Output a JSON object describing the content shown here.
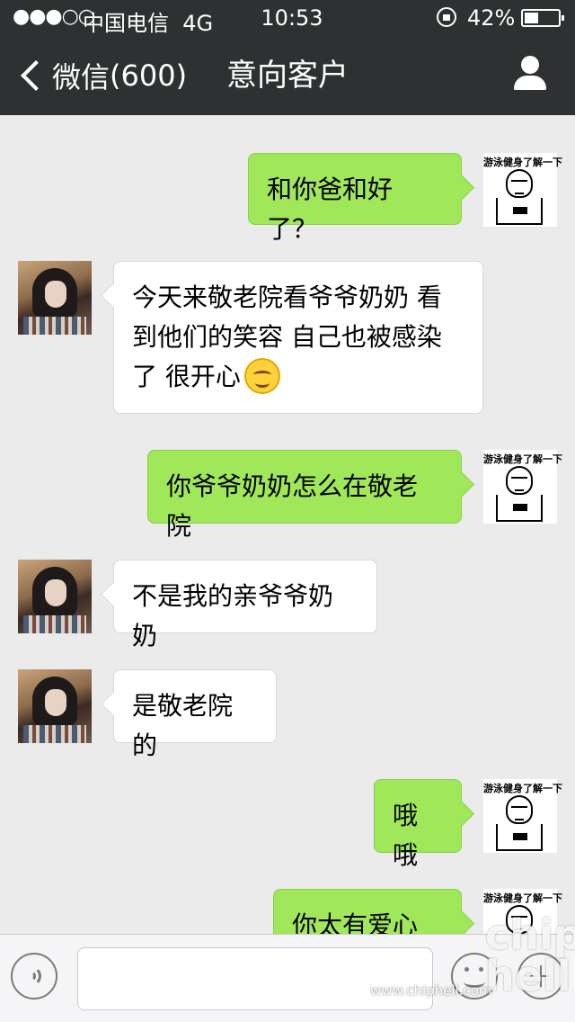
{
  "status_bar": {
    "signal": "●●●○○",
    "carrier": "中国电信",
    "network": "4G",
    "time": "10:53",
    "battery_percent": "42%",
    "battery_level": 0.42
  },
  "nav": {
    "back_label": "微信",
    "back_count": "(600)",
    "title": "意向客户",
    "profile_icon": "person-icon"
  },
  "contact_avatar_icon": "girl-photo-avatar",
  "my_avatar": {
    "caption": "游泳健身了解一下"
  },
  "messages": [
    {
      "side": "out",
      "text": "和你爸和好了？"
    },
    {
      "side": "in",
      "text": "今天来敬老院看爷爷奶奶 看到他们的笑容 自己也被感染了 很开心",
      "emoji": "smiling-face-emoji"
    },
    {
      "side": "out",
      "text": "你爷爷奶奶怎么在敬老院"
    },
    {
      "side": "in",
      "text": "不是我的亲爷爷奶奶"
    },
    {
      "side": "in",
      "text": "是敬老院的"
    },
    {
      "side": "out",
      "text": "哦哦"
    },
    {
      "side": "out",
      "text": "你太有爱心了"
    }
  ],
  "input_bar": {
    "voice_icon": "voice-icon",
    "emoji_icon": "emoji-icon",
    "more_icon": "plus-icon",
    "text_value": ""
  },
  "watermark": {
    "logo": "chip hell",
    "url": "www.chiphell.com"
  }
}
